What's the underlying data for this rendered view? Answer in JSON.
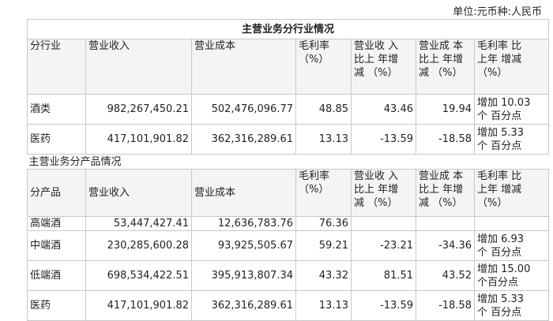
{
  "unit_label": "单位:元币种:人民币",
  "industry_section": {
    "title": "主营业务分行业情况",
    "headers": [
      "分行业",
      "营业收入",
      "营业成本",
      "毛利率\n（%）",
      "营业收 入\n比上 年增\n减 （%）",
      "营业成 本\n比上 年增\n减 （%）",
      "毛利率 比\n上年 增减\n（%）"
    ],
    "rows": [
      [
        "酒类",
        "982,267,450.21",
        "502,476,096.77",
        "48.85",
        "43.46",
        "19.94",
        "增加 10.03\n个 百分点"
      ],
      [
        "医药",
        "417,101,901.82",
        "362,316,289.61",
        "13.13",
        "-13.59",
        "-18.58",
        "增加 5.33\n个 百分点"
      ]
    ]
  },
  "product_section": {
    "title": "主营业务分产品情况",
    "headers": [
      "分产品",
      "营业收入",
      "营业成本",
      "毛利率\n（%）",
      "营业收 入\n比上 年增\n减 （%）",
      "营业成 本\n比上 年增\n减 （%）",
      "毛利率 比\n上年 增减\n（%）"
    ],
    "rows": [
      [
        "高端酒",
        "53,447,427.41",
        "12,636,783.76",
        "76.36",
        "",
        "",
        ""
      ],
      [
        "中端酒",
        "230,285,600.28",
        "93,925,505.67",
        "59.21",
        "-23.21",
        "-34.36",
        "增加 6.93\n个 百分点"
      ],
      [
        "低端酒",
        "698,534,422.51",
        "395,913,807.34",
        "43.32",
        "81.51",
        "43.52",
        "增加 15.00\n个百分点"
      ],
      [
        "医药",
        "417,101,901.82",
        "362,316,289.61",
        "13.13",
        "-13.59",
        "-18.58",
        "增加 5.33\n个 百分点"
      ]
    ]
  }
}
